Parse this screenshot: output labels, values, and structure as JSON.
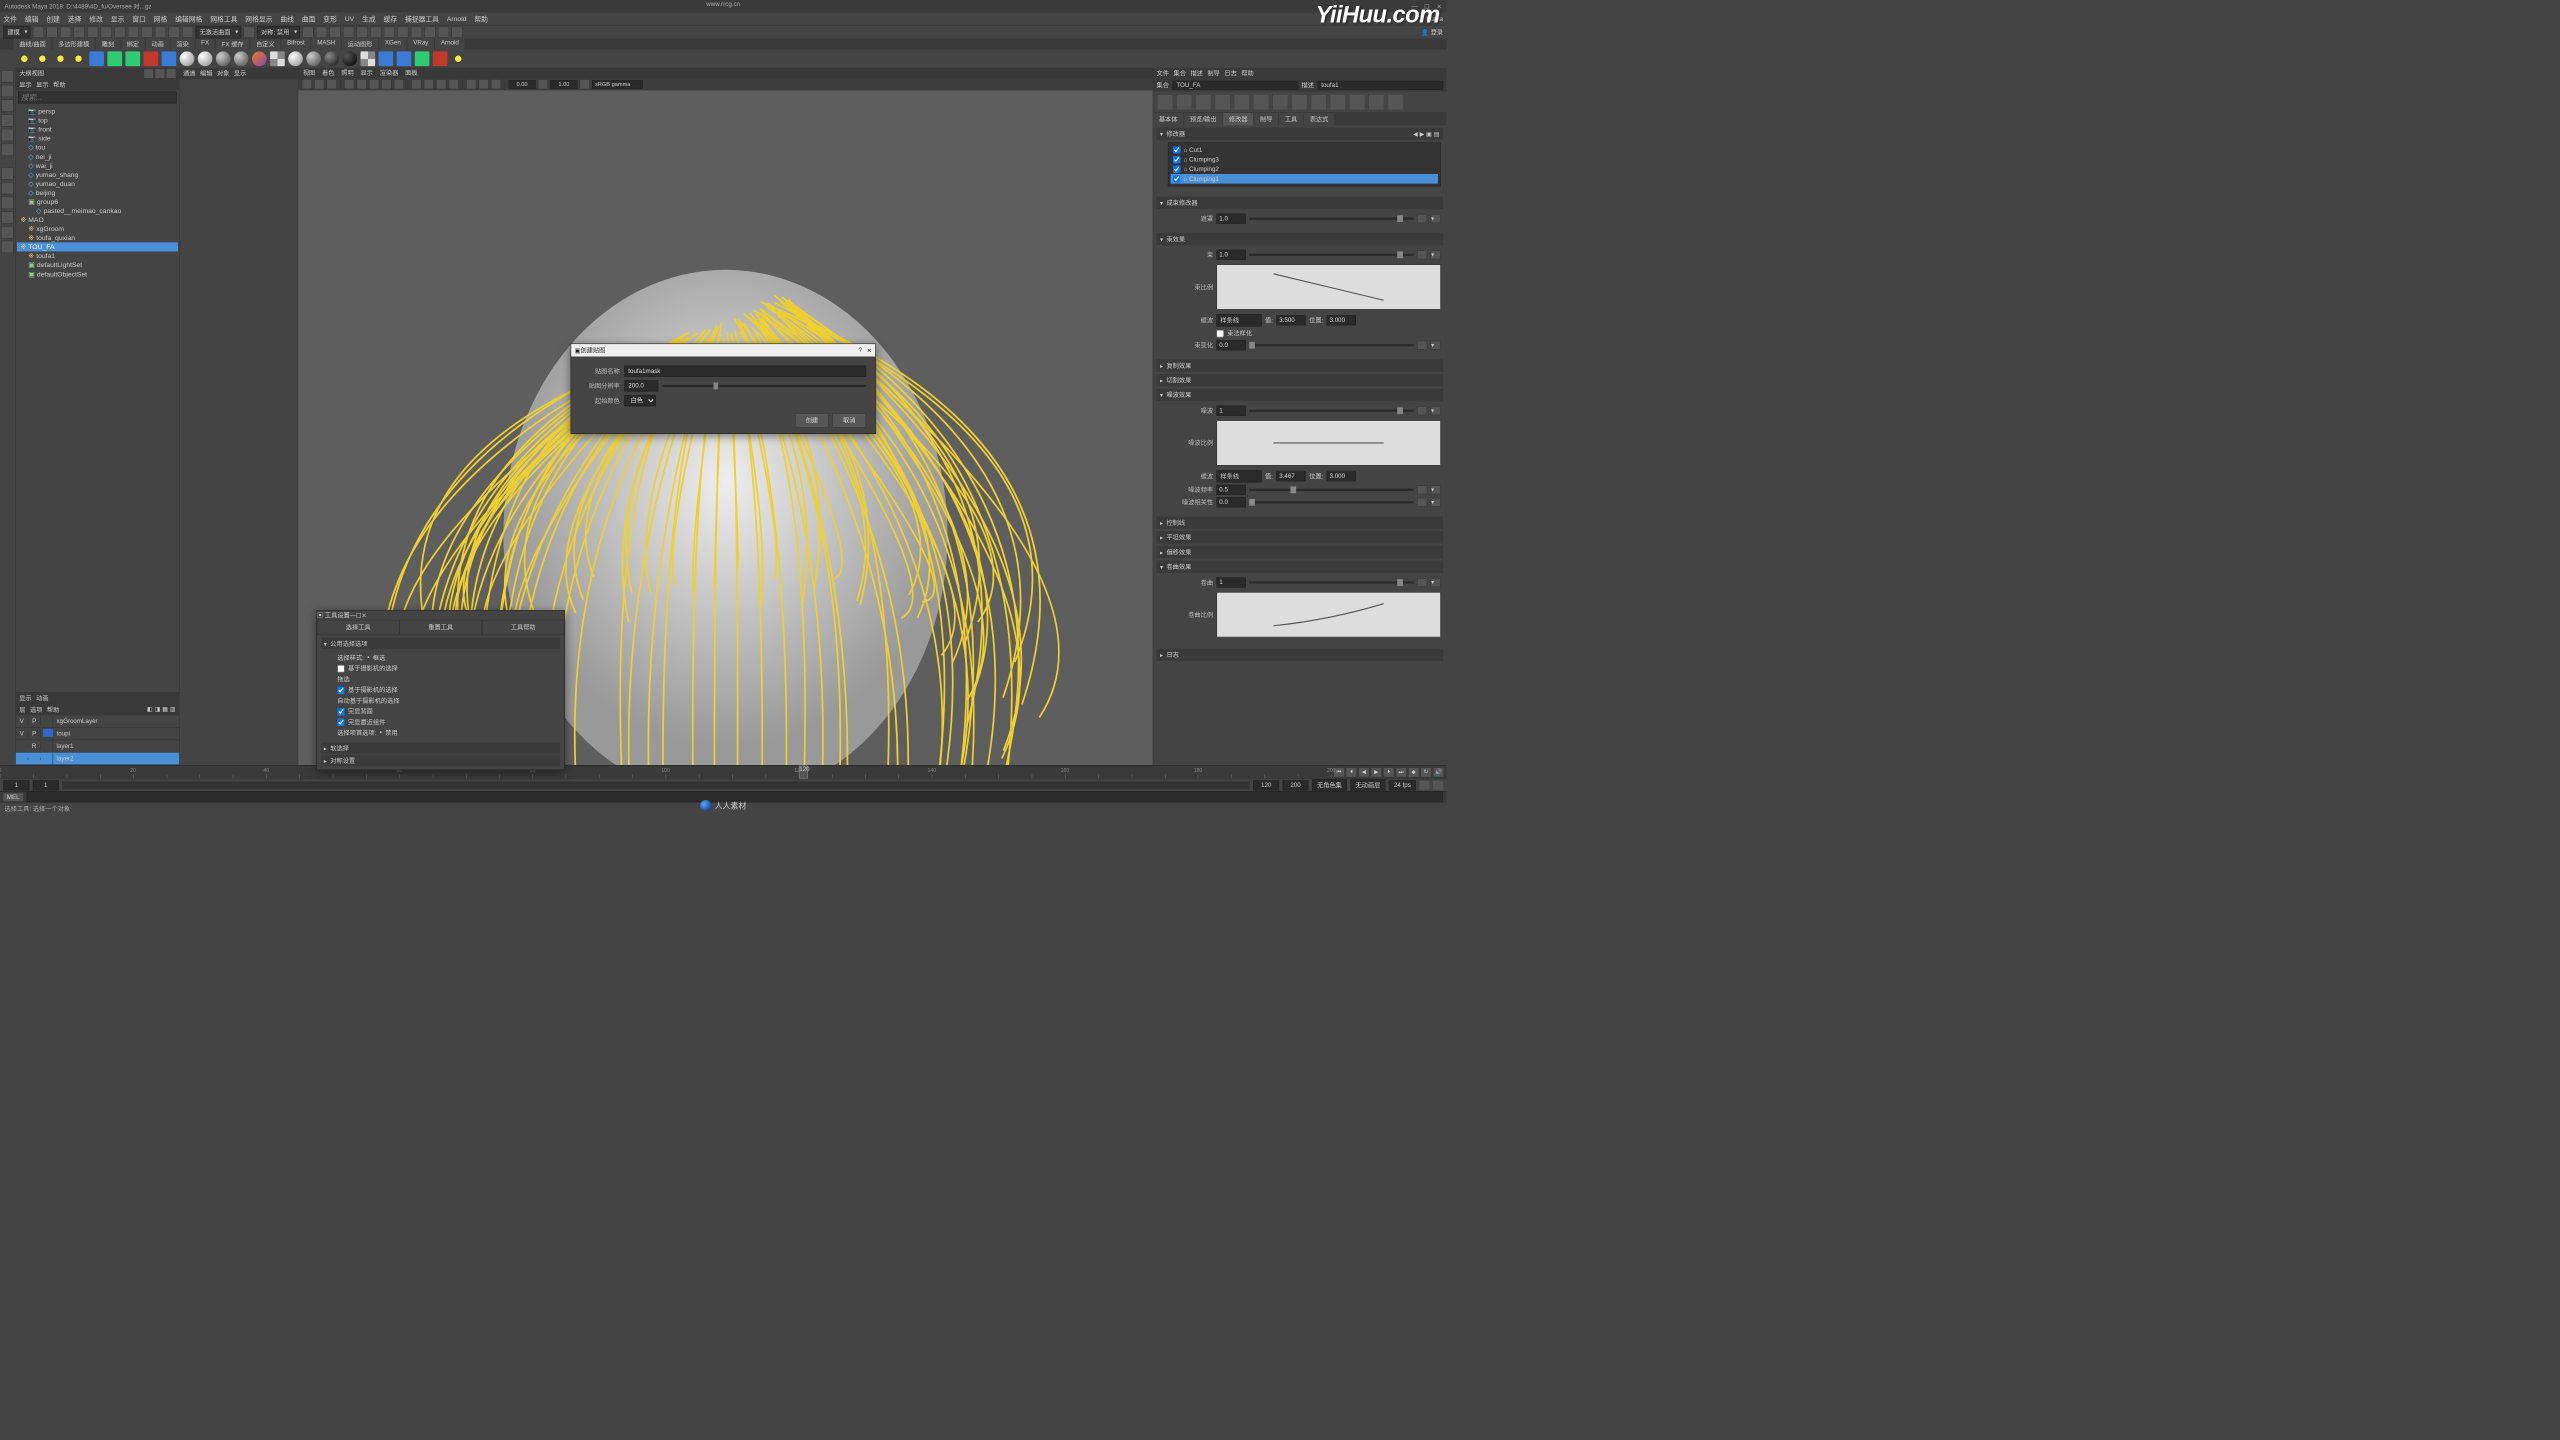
{
  "app": {
    "title": "Autodesk Maya 2018: D:\\4489\\4D_fu/Oversee 对...gz",
    "mode_label": "Maya"
  },
  "center_url": "www.rrcg.cn",
  "big_logo": "YiiHuu.com",
  "menubar": [
    "文件",
    "编辑",
    "创建",
    "选择",
    "修改",
    "显示",
    "窗口",
    "网格",
    "编辑网格",
    "网格工具",
    "网格显示",
    "曲线",
    "曲面",
    "变形",
    "UV",
    "生成",
    "缓存",
    "捕捉器工具",
    "Arnold",
    "帮助"
  ],
  "shelf1": {
    "workspace": "建模",
    "no_active_surface": "无激活曲面",
    "sym_label": "对称: 禁用"
  },
  "shelftabs": [
    "曲线/曲面",
    "多边形建模",
    "雕刻",
    "绑定",
    "动画",
    "渲染",
    "FX",
    "FX 缓存",
    "自定义",
    "Bifrost",
    "MASH",
    "运动图形",
    "XGen",
    "VRay",
    "Arnold"
  ],
  "vp_menus": [
    "视图",
    "着色",
    "照明",
    "显示",
    "渲染器",
    "面板"
  ],
  "vp_toolbar": {
    "val1": "0.00",
    "val2": "1.00",
    "gamma_combo": "sRGB gamma"
  },
  "outliner": {
    "title": "大纲视图",
    "menus": [
      "显示",
      "显示",
      "帮助"
    ],
    "search_placeholder": "搜索...",
    "tree": [
      {
        "kind": "cam",
        "name": "persp",
        "indent": 1
      },
      {
        "kind": "cam",
        "name": "top",
        "indent": 1
      },
      {
        "kind": "cam",
        "name": "front",
        "indent": 1
      },
      {
        "kind": "cam",
        "name": "side",
        "indent": 1
      },
      {
        "kind": "mesh",
        "name": "tou",
        "indent": 1
      },
      {
        "kind": "mesh",
        "name": "nei_ji",
        "indent": 1
      },
      {
        "kind": "mesh",
        "name": "wai_ji",
        "indent": 1
      },
      {
        "kind": "mesh",
        "name": "yumao_shang",
        "indent": 1
      },
      {
        "kind": "mesh",
        "name": "yumao_duan",
        "indent": 1
      },
      {
        "kind": "mesh",
        "name": "beijing",
        "indent": 1
      },
      {
        "kind": "grp",
        "name": "group6",
        "indent": 1
      },
      {
        "kind": "mesh",
        "name": "pasted__meimao_cankao",
        "indent": 2
      },
      {
        "kind": "xgen",
        "name": "MAO",
        "indent": 0
      },
      {
        "kind": "xgen",
        "name": "xgGroom",
        "indent": 1
      },
      {
        "kind": "xgen",
        "name": "toufa_quxian",
        "indent": 1
      },
      {
        "kind": "xgen",
        "name": "TOU_FA",
        "indent": 0,
        "sel": true
      },
      {
        "kind": "xgen",
        "name": "toufa1",
        "indent": 1
      },
      {
        "kind": "grp",
        "name": "defaultLightSet",
        "indent": 1
      },
      {
        "kind": "grp",
        "name": "defaultObjectSet",
        "indent": 1
      }
    ]
  },
  "channelbox": {
    "menus": [
      "通道",
      "编辑",
      "对象",
      "显示"
    ]
  },
  "layerpanel": {
    "tabs": [
      "显示",
      "动画"
    ],
    "opts": [
      "层",
      "选项",
      "帮助"
    ],
    "rows": [
      {
        "v": "V",
        "p": "P",
        "color": "",
        "name": "xgGroomLayer"
      },
      {
        "v": "V",
        "p": "P",
        "color": "#36c",
        "name": "toupi"
      },
      {
        "v": "",
        "p": "R",
        "color": "",
        "name": "layer1"
      },
      {
        "v": "",
        "p": "",
        "color": "",
        "name": "layer2",
        "sel": true
      }
    ]
  },
  "dialog_createmap": {
    "title": "创建贴图",
    "name_label": "贴图名称",
    "name_value": "toufa1mask",
    "res_label": "贴图分辨率",
    "res_value": "200.0",
    "color_label": "起始颜色",
    "color_value": "白色",
    "btn_create": "创建",
    "btn_cancel": "取消"
  },
  "toolset": {
    "win_title": "工具设置",
    "tab_tool": "选择工具",
    "tab_reset": "重置工具",
    "tab_help": "工具帮助",
    "sec_common": "公用选择选项",
    "style_label": "选择样式:",
    "style_val": "框选",
    "chk1": "基于摄影机的选择",
    "chk2": "拖选",
    "chk3": "基于摄影机的选择",
    "chk4": "自动基于摄影机的选择",
    "chk5": "完显背面",
    "chk6": "完显最近组件",
    "pref_label": "选择项首选项:",
    "pref_val": "禁用",
    "sec_soft": "软选择",
    "sec_sym": "对称设置"
  },
  "xgen": {
    "menus": [
      "文件",
      "集合",
      "描述",
      "制导",
      "日志",
      "帮助"
    ],
    "collection_label": "集合",
    "collection_value": "TOU_FA",
    "desc_label": "描述",
    "desc_value": "toufa1",
    "tabs": [
      "基本体",
      "预览/输出",
      "修改器",
      "制导",
      "工具",
      "表达式"
    ],
    "active_tab_index": 2,
    "sec_modifiers": "修改器",
    "modifiers": [
      {
        "on": true,
        "name": "Cut1"
      },
      {
        "on": true,
        "name": "Clumping3"
      },
      {
        "on": true,
        "name": "Clumping2"
      },
      {
        "on": true,
        "name": "Clumping1",
        "sel": true
      }
    ],
    "sec_clump_mod": "成束修改器",
    "mask_label": "遮罩",
    "mask_value": "1.0",
    "sec_clump_fx": "束效果",
    "clump_label": "束",
    "clump_value": "1.0",
    "ratio_label": "束比例",
    "curve1_mode_label": "缓波",
    "curve1_mode_value": "样条线",
    "curve1_val_label": "值:",
    "curve1_val": "3.500",
    "curve1_pos_label": "位置:",
    "curve1_pos": "3.000",
    "chk_paramize": "束法样化",
    "var_label": "束变化",
    "var_value": "0.0",
    "sec_copy": "复制效果",
    "sec_cut": "切割效果",
    "sec_noise": "噪波效果",
    "noise_label": "噪波",
    "noise_value": "1",
    "noise_ratio_label": "噪波比例",
    "curve2_mode_value": "样条线",
    "curve2_val": "3.467",
    "curve2_pos": "3.000",
    "noise_freq_label": "噪波频率",
    "noise_freq_value": "0.5",
    "noise_rel_label": "噪波相关性",
    "noise_rel_value": "0.0",
    "sec_control": "控制线",
    "sec_flat": "平坦效果",
    "sec_offset": "偏移效果",
    "sec_curl": "卷曲效果",
    "curl_label": "卷曲",
    "curl_value": "1",
    "curl_ratio_label": "卷曲比例",
    "sec_log": "日志"
  },
  "timeline": {
    "start": 1,
    "end": 200,
    "current": 120,
    "range_start": 1,
    "range_end": 120,
    "range_outer_start": 1,
    "range_outer_end": 200,
    "no_char_set": "无角色集",
    "no_anim_layer": "无动画层",
    "fps": "24 fps"
  },
  "cmdline": {
    "mel": "MEL"
  },
  "helpline": "选择工具: 选择一个对象",
  "footer_logo": "人人素材"
}
